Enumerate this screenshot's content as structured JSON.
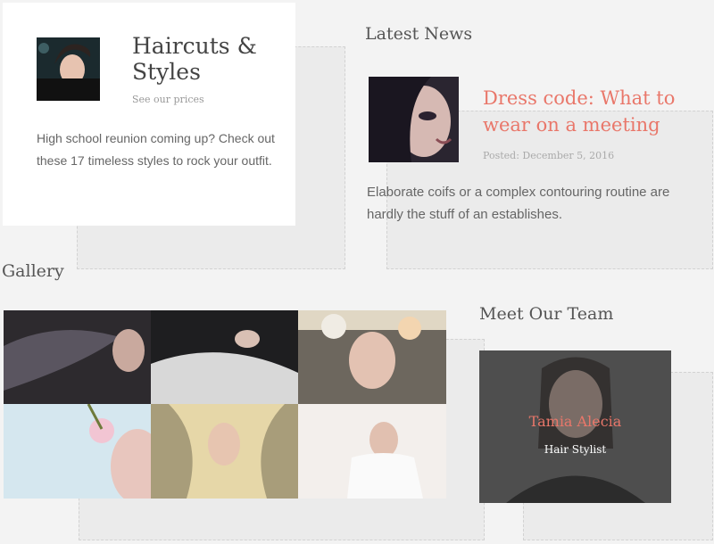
{
  "haircuts": {
    "title": "Haircuts & Styles",
    "link": "See our prices",
    "body": "High school reunion coming up? Check out these 17 timeless styles to rock your outfit."
  },
  "news": {
    "section_title": "Latest News",
    "title": "Dress code: What to wear on a meeting",
    "date": "Posted: December 5, 2016",
    "body": "Elaborate coifs or a complex contouring routine are hardly the stuff of an establishes."
  },
  "gallery": {
    "section_title": "Gallery"
  },
  "team": {
    "section_title": "Meet Our Team",
    "member_name": "Tamia Alecia",
    "member_role": "Hair Stylist"
  }
}
